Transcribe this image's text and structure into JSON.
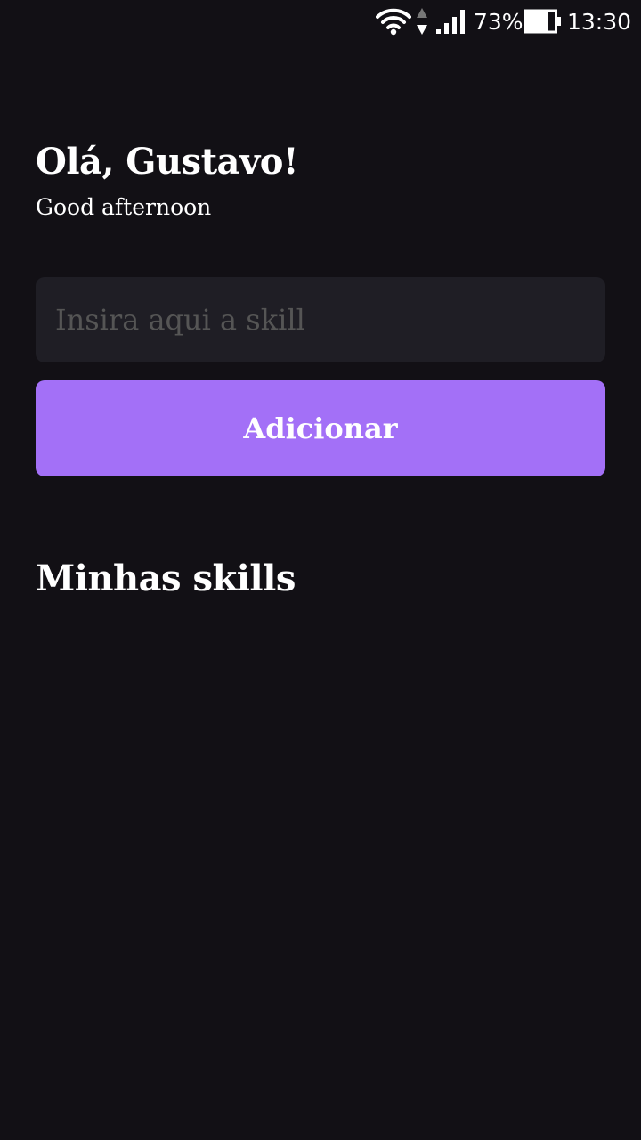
{
  "status_bar": {
    "wifi_icon": "wifi-icon",
    "data_icon": "data-transfer-icon",
    "signal_icon": "cell-signal-icon",
    "battery_percent": "73%",
    "battery_icon": "battery-icon",
    "battery_level": 0.73,
    "time": "13:30"
  },
  "header": {
    "greeting": "Olá, Gustavo!",
    "subgreeting": "Good afternoon"
  },
  "form": {
    "input_placeholder": "Insira aqui a skill",
    "input_value": "",
    "add_button_label": "Adicionar"
  },
  "skills": {
    "title": "Minhas skills",
    "items": []
  },
  "colors": {
    "background": "#121015",
    "input_background": "#1f1e25",
    "accent": "#a370f7",
    "text": "#ffffff",
    "placeholder": "#555555"
  }
}
